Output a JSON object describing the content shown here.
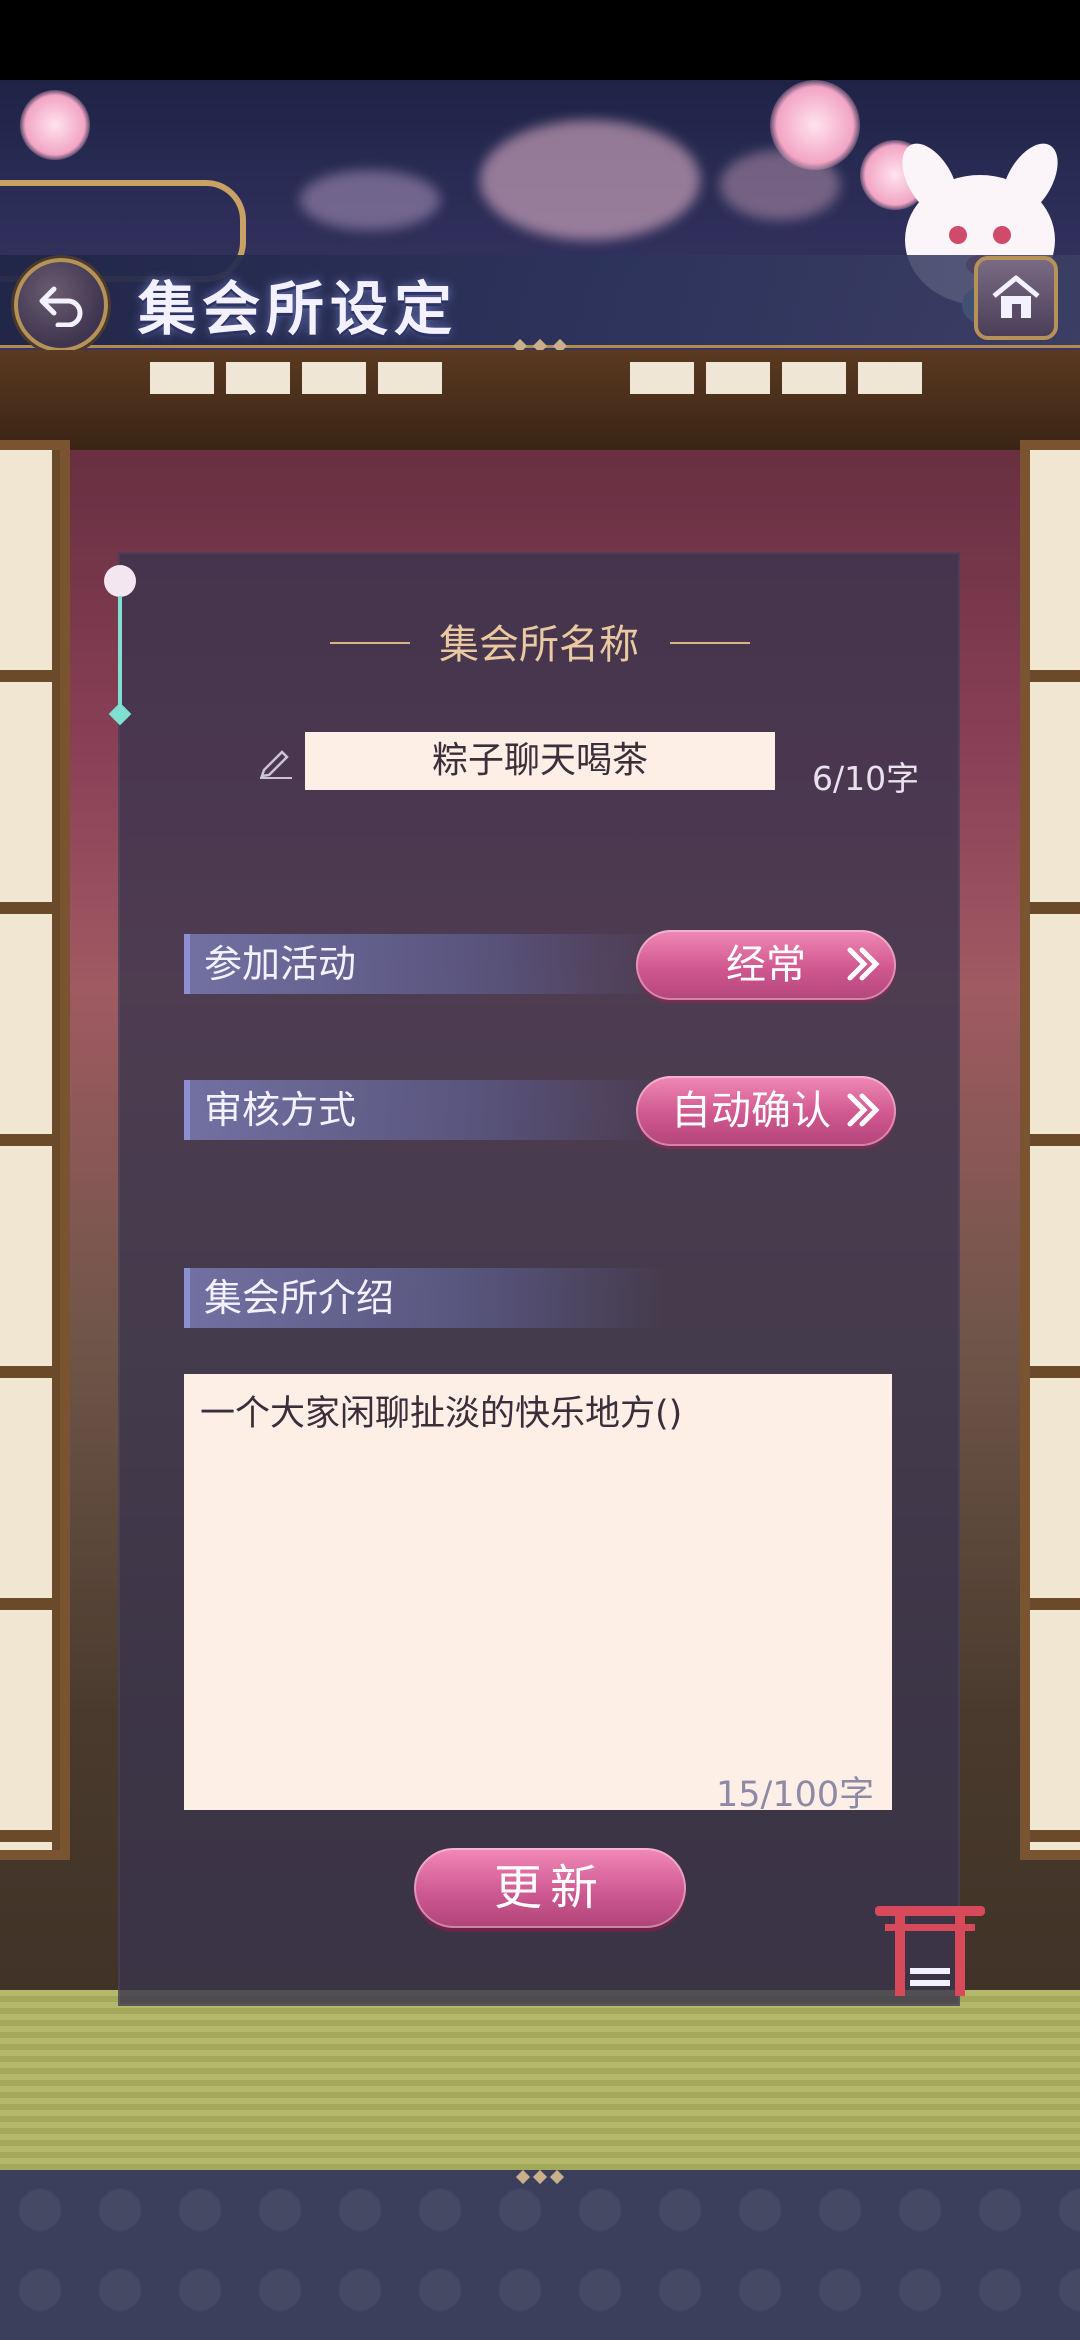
{
  "header": {
    "title": "集会所设定"
  },
  "panel": {
    "section_title": "集会所名称",
    "name_value": "粽子聊天喝茶",
    "name_count": "6/10字",
    "rows": [
      {
        "label": "参加活动",
        "button": "经常"
      },
      {
        "label": "审核方式",
        "button": "自动确认"
      }
    ],
    "intro_label": "集会所介绍",
    "intro_text": "一个大家闲聊扯淡的快乐地方()",
    "intro_count": "15/100字",
    "update_button": "更新"
  },
  "colors": {
    "accent_pink": "#d0578f",
    "panel_bg": "#3a344e",
    "input_bg": "#fdeee6",
    "gold": "#b79258"
  },
  "icons": [
    "back-arrow-icon",
    "home-icon",
    "pencil-icon",
    "chevron-right-icon",
    "torii-gate-icon"
  ]
}
